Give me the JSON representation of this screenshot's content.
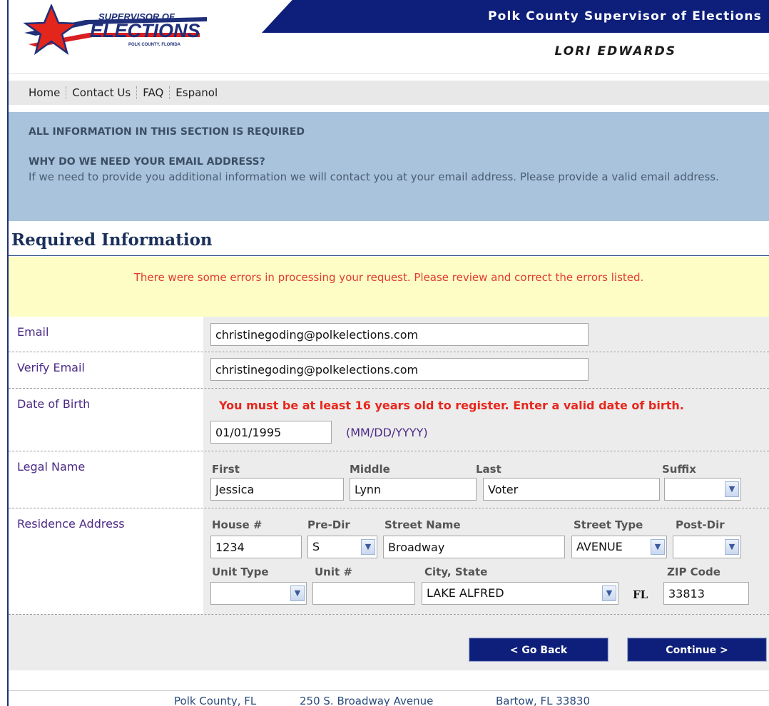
{
  "header": {
    "logo_line1": "SUPERVISOR OF",
    "logo_line2": "ELECTIONS",
    "logo_line3": "POLK COUNTY, FLORIDA",
    "title": "Polk County Supervisor of Elections",
    "name": "LORI EDWARDS"
  },
  "nav": {
    "items": [
      "Home",
      "Contact Us",
      "FAQ",
      "Espanol"
    ]
  },
  "info": {
    "required_note": "ALL INFORMATION IN THIS SECTION IS REQUIRED",
    "why_heading": "WHY DO WE NEED YOUR EMAIL ADDRESS?",
    "why_text": "If we need to provide you additional information we will contact you at your email address. Please provide a valid email address."
  },
  "section": {
    "title": "Required Information",
    "error_message": "There were some errors in processing your request. Please review and correct the errors listed."
  },
  "form": {
    "email": {
      "label": "Email",
      "value": "christinegoding@polkelections.com"
    },
    "verify_email": {
      "label": "Verify Email",
      "value": "christinegoding@polkelections.com"
    },
    "dob": {
      "label": "Date of Birth",
      "error": "You must be at least 16 years old to register. Enter a valid date of birth.",
      "value": "01/01/1995",
      "format": "(MM/DD/YYYY)"
    },
    "legal_name": {
      "label": "Legal Name",
      "first_label": "First",
      "first": "Jessica",
      "middle_label": "Middle",
      "middle": "Lynn",
      "last_label": "Last",
      "last": "Voter",
      "suffix_label": "Suffix",
      "suffix": ""
    },
    "address": {
      "label": "Residence Address",
      "house_label": "House #",
      "house": "1234",
      "predir_label": "Pre-Dir",
      "predir": "S",
      "street_label": "Street Name",
      "street": "Broadway",
      "street_type_label": "Street Type",
      "street_type": "AVENUE",
      "postdir_label": "Post-Dir",
      "postdir": "",
      "unit_type_label": "Unit Type",
      "unit_type": "",
      "unit_label": "Unit #",
      "unit": "",
      "city_label": "City, State",
      "city": "LAKE ALFRED",
      "state": "FL",
      "zip_label": "ZIP Code",
      "zip": "33813"
    }
  },
  "buttons": {
    "back": "< Go Back",
    "continue": "Continue >"
  },
  "footer": {
    "county": "Polk County, FL",
    "street": "250 S. Broadway Avenue",
    "city": "Bartow, FL 33830"
  },
  "colors": {
    "navy": "#0d1f7a",
    "info_bg": "#a9c3dc",
    "error_bg": "#fefdc5",
    "error_text": "#e23b2e",
    "label_purple": "#4b2a86"
  }
}
